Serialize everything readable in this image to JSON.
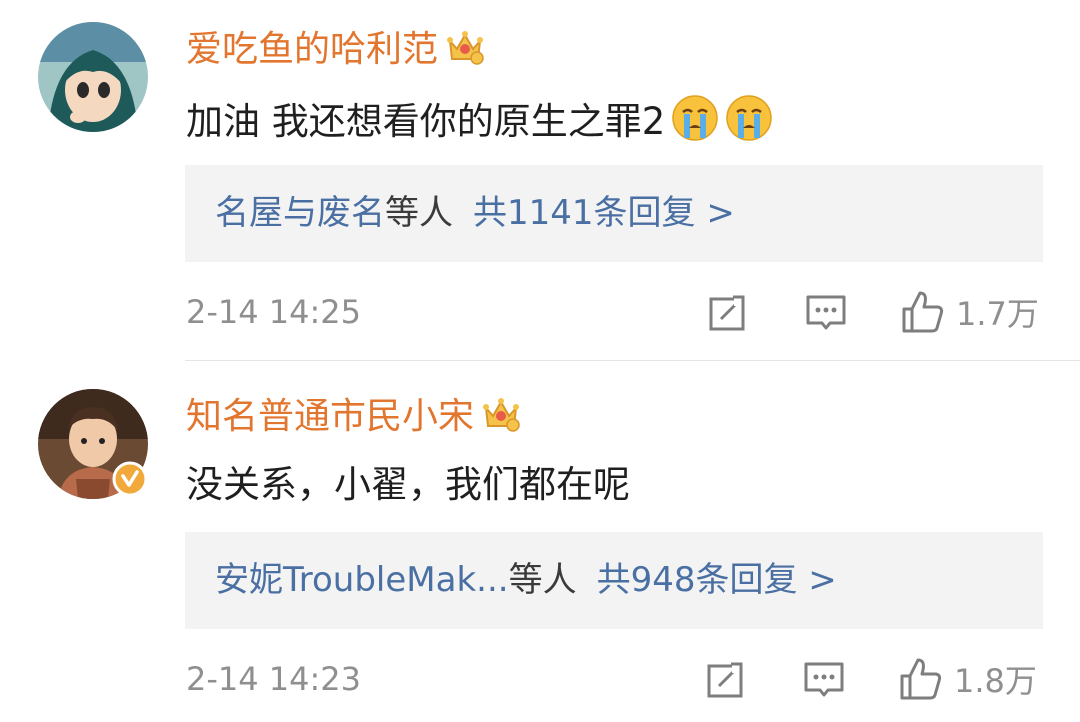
{
  "comments": [
    {
      "username": "爱吃鱼的哈利范",
      "badge_icon": "crown-icon",
      "text": "加油 我还想看你的原生之罪2",
      "emojis": [
        "crying-face-icon",
        "crying-face-icon"
      ],
      "replies": {
        "names": "名屋与废名",
        "etal": "等人",
        "count_label": "共1141条回复 >"
      },
      "timestamp": "2-14 14:25",
      "likes": "1.7万"
    },
    {
      "username": "知名普通市民小宋",
      "badge_icon": "crown-icon",
      "verified_icon": "verified-badge-icon",
      "text": "没关系，小翟，我们都在呢",
      "replies": {
        "names": "安妮TroubleMak...",
        "etal": "等人",
        "count_label": "共948条回复 >"
      },
      "timestamp": "2-14 14:23",
      "likes": "1.8万"
    }
  ],
  "colors": {
    "username": "#e3762f",
    "reply_link": "#4a6fa3",
    "reply_bg": "#f3f3f3",
    "meta": "#8f8f8f",
    "text": "#1f1f1f"
  }
}
